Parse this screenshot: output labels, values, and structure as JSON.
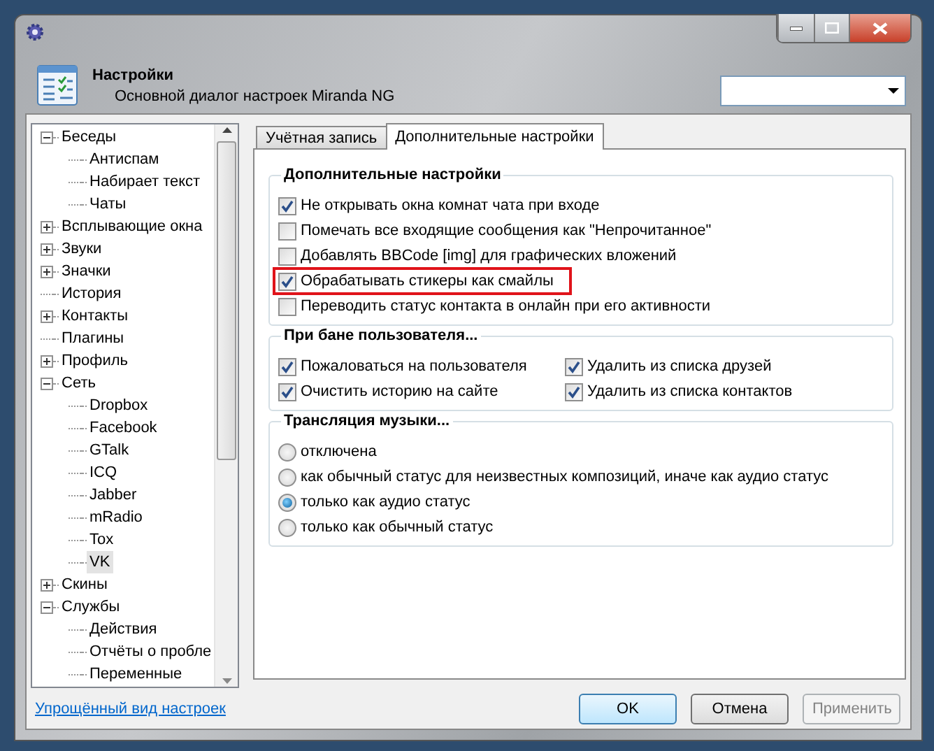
{
  "window": {
    "title": "Настройки",
    "subtitle": "Основной диалог настроек Miranda NG"
  },
  "tree": [
    {
      "label": "Беседы",
      "expanded": true,
      "selected": false,
      "children": [
        {
          "label": "Антиспам",
          "selected": false
        },
        {
          "label": "Набирает текст",
          "selected": false
        },
        {
          "label": "Чаты",
          "selected": false
        }
      ]
    },
    {
      "label": "Всплывающие окна",
      "expanded": false,
      "selected": false
    },
    {
      "label": "Звуки",
      "expanded": false,
      "selected": false
    },
    {
      "label": "Значки",
      "expanded": false,
      "selected": false
    },
    {
      "label": "История",
      "selected": false
    },
    {
      "label": "Контакты",
      "expanded": false,
      "selected": false
    },
    {
      "label": "Плагины",
      "selected": false
    },
    {
      "label": "Профиль",
      "expanded": false,
      "selected": false
    },
    {
      "label": "Сеть",
      "expanded": true,
      "selected": false,
      "children": [
        {
          "label": "Dropbox",
          "selected": false
        },
        {
          "label": "Facebook",
          "selected": false
        },
        {
          "label": "GTalk",
          "selected": false
        },
        {
          "label": "ICQ",
          "selected": false
        },
        {
          "label": "Jabber",
          "selected": false
        },
        {
          "label": "mRadio",
          "selected": false
        },
        {
          "label": "Tox",
          "selected": false
        },
        {
          "label": "VK",
          "selected": true
        }
      ]
    },
    {
      "label": "Скины",
      "expanded": false,
      "selected": false
    },
    {
      "label": "Службы",
      "expanded": true,
      "selected": false,
      "children": [
        {
          "label": "Действия",
          "selected": false
        },
        {
          "label": "Отчёты о пробле",
          "selected": false
        },
        {
          "label": "Переменные",
          "selected": false
        }
      ]
    }
  ],
  "tabs": [
    {
      "label": "Учётная запись",
      "selected": false
    },
    {
      "label": "Дополнительные настройки",
      "selected": true
    }
  ],
  "groups": [
    {
      "title": "Дополнительные настройки",
      "kind": "list",
      "items": [
        {
          "kind": "checkbox",
          "label": "Не открывать окна комнат чата при входе",
          "checked": true
        },
        {
          "kind": "checkbox",
          "label": "Помечать все входящие сообщения как \"Непрочитанное\"",
          "checked": false
        },
        {
          "kind": "checkbox",
          "label": "Добавлять BBCode [img] для графических вложений",
          "checked": false
        },
        {
          "kind": "checkbox",
          "label": "Обрабатывать стикеры как смайлы",
          "checked": true,
          "highlighted": true
        },
        {
          "kind": "checkbox",
          "label": "Переводить статус контакта в онлайн при его активности",
          "checked": false
        }
      ]
    },
    {
      "title": "При бане пользователя...",
      "kind": "grid",
      "items": [
        {
          "kind": "checkbox",
          "label": "Пожаловаться на пользователя",
          "checked": true
        },
        {
          "kind": "checkbox",
          "label": "Удалить из списка друзей",
          "checked": true
        },
        {
          "kind": "checkbox",
          "label": "Очистить историю на сайте",
          "checked": true
        },
        {
          "kind": "checkbox",
          "label": "Удалить из списка контактов",
          "checked": true
        }
      ]
    },
    {
      "title": "Трансляция музыки...",
      "kind": "list",
      "items": [
        {
          "kind": "radio",
          "label": "отключена",
          "selected": false
        },
        {
          "kind": "radio",
          "label": "как обычный статус для неизвестных композиций, иначе как аудио статус",
          "selected": false
        },
        {
          "kind": "radio",
          "label": "только как аудио статус",
          "selected": true
        },
        {
          "kind": "radio",
          "label": "только как обычный статус",
          "selected": false
        }
      ]
    }
  ],
  "footer": {
    "link": "Упрощённый вид настроек",
    "buttons": [
      {
        "label": "OK",
        "default": true,
        "disabled": false
      },
      {
        "label": "Отмена",
        "default": false,
        "disabled": false
      },
      {
        "label": "Применить",
        "default": false,
        "disabled": true
      }
    ]
  }
}
